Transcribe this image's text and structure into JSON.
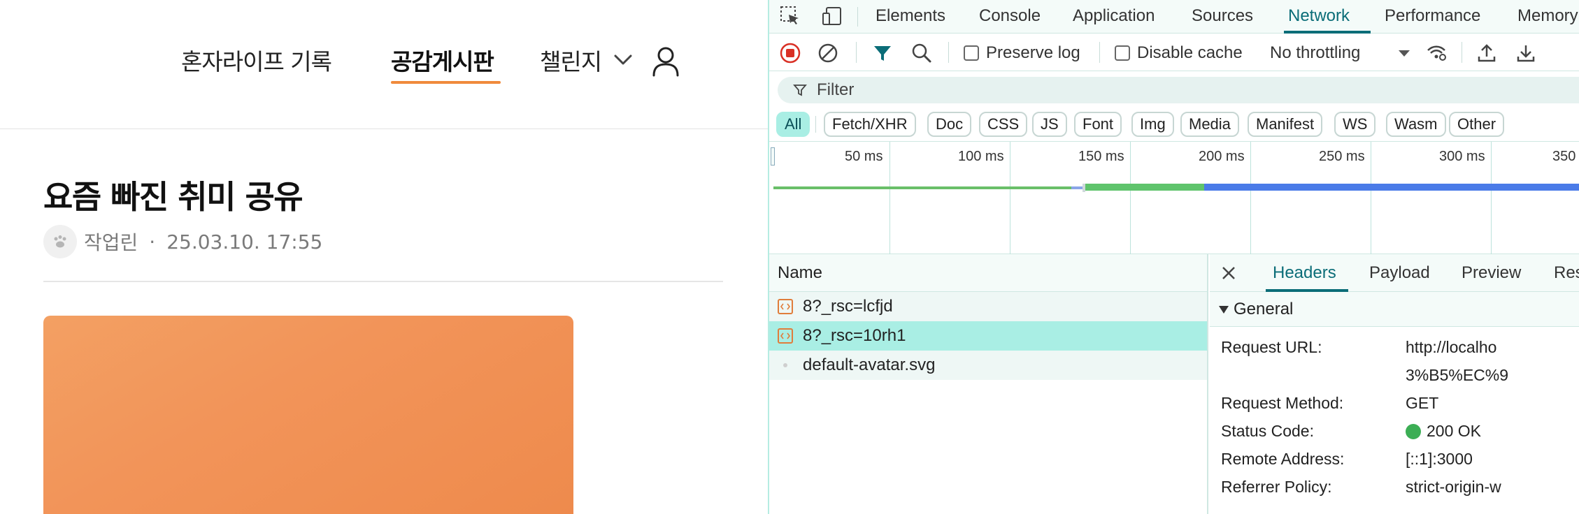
{
  "site": {
    "nav": {
      "record": "혼자라이프 기록",
      "board": "공감게시판",
      "challenge": "챌린지"
    },
    "post": {
      "title": "요즘 빠진 취미 공유",
      "author": "작업린",
      "separator": "·",
      "date": "25.03.10. 17:55"
    },
    "colors": {
      "accent": "#f08a3c",
      "image": "#f29459"
    }
  },
  "devtools": {
    "tabs": [
      "Elements",
      "Console",
      "Application",
      "Sources",
      "Network",
      "Performance",
      "Memory"
    ],
    "active_tab": "Network",
    "toolbar": {
      "preserve_log": "Preserve log",
      "disable_cache": "Disable cache",
      "throttling": "No throttling"
    },
    "filter_placeholder": "Filter",
    "types": [
      "All",
      "Fetch/XHR",
      "Doc",
      "CSS",
      "JS",
      "Font",
      "Img",
      "Media",
      "Manifest",
      "WS",
      "Wasm",
      "Other"
    ],
    "active_type": "All",
    "timeline": {
      "ticks": [
        "50 ms",
        "100 ms",
        "150 ms",
        "200 ms",
        "250 ms",
        "300 ms",
        "350"
      ]
    },
    "requests": {
      "header": "Name",
      "rows": [
        {
          "name": "8?_rsc=lcfjd",
          "icon": "document-icon"
        },
        {
          "name": "8?_rsc=10rh1",
          "icon": "document-icon",
          "selected": true
        },
        {
          "name": "default-avatar.svg",
          "icon": "image-icon"
        }
      ]
    },
    "details": {
      "tabs": [
        "Headers",
        "Payload",
        "Preview",
        "Res"
      ],
      "active_tab": "Headers",
      "section": "General",
      "rows": [
        {
          "key": "Request URL:",
          "value": "http://localho"
        },
        {
          "key": "",
          "value": "3%B5%EC%9"
        },
        {
          "key": "Request Method:",
          "value": "GET"
        },
        {
          "key": "Status Code:",
          "value": "200 OK"
        },
        {
          "key": "Remote Address:",
          "value": "[::1]:3000"
        },
        {
          "key": "Referrer Policy:",
          "value": "strict-origin-w"
        }
      ]
    },
    "colors": {
      "accent": "#0b6d78",
      "selected": "#a9eee4",
      "status_ok": "#3cae55"
    }
  }
}
